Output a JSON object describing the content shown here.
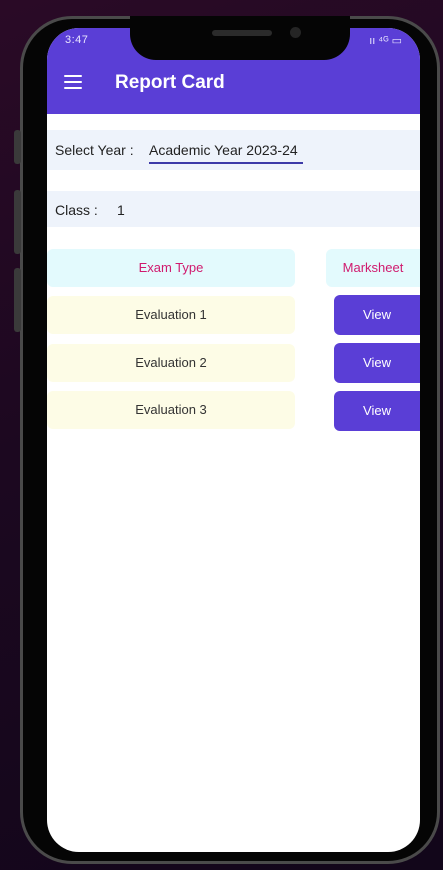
{
  "status_bar": {
    "time": "3:47",
    "icons_text": "ıı ⁴ᴳ ▭"
  },
  "app_bar": {
    "title": "Report Card",
    "menu_icon": "hamburger-menu-icon"
  },
  "filters": {
    "year_label": "Select Year :",
    "year_value": "Academic Year 2023-24",
    "class_label": "Class :",
    "class_value": "1"
  },
  "table": {
    "headers": {
      "exam_type": "Exam Type",
      "marksheet": "Marksheet"
    },
    "rows": [
      {
        "exam": "Evaluation 1",
        "action": "View"
      },
      {
        "exam": "Evaluation 2",
        "action": "View"
      },
      {
        "exam": "Evaluation 3",
        "action": "View"
      }
    ]
  },
  "colors": {
    "primary": "#5a3ed6",
    "header_text": "#d01a6e",
    "header_bg": "#e3fafd",
    "row_bg": "#fdfce6",
    "filter_bg": "#eef3fb"
  }
}
